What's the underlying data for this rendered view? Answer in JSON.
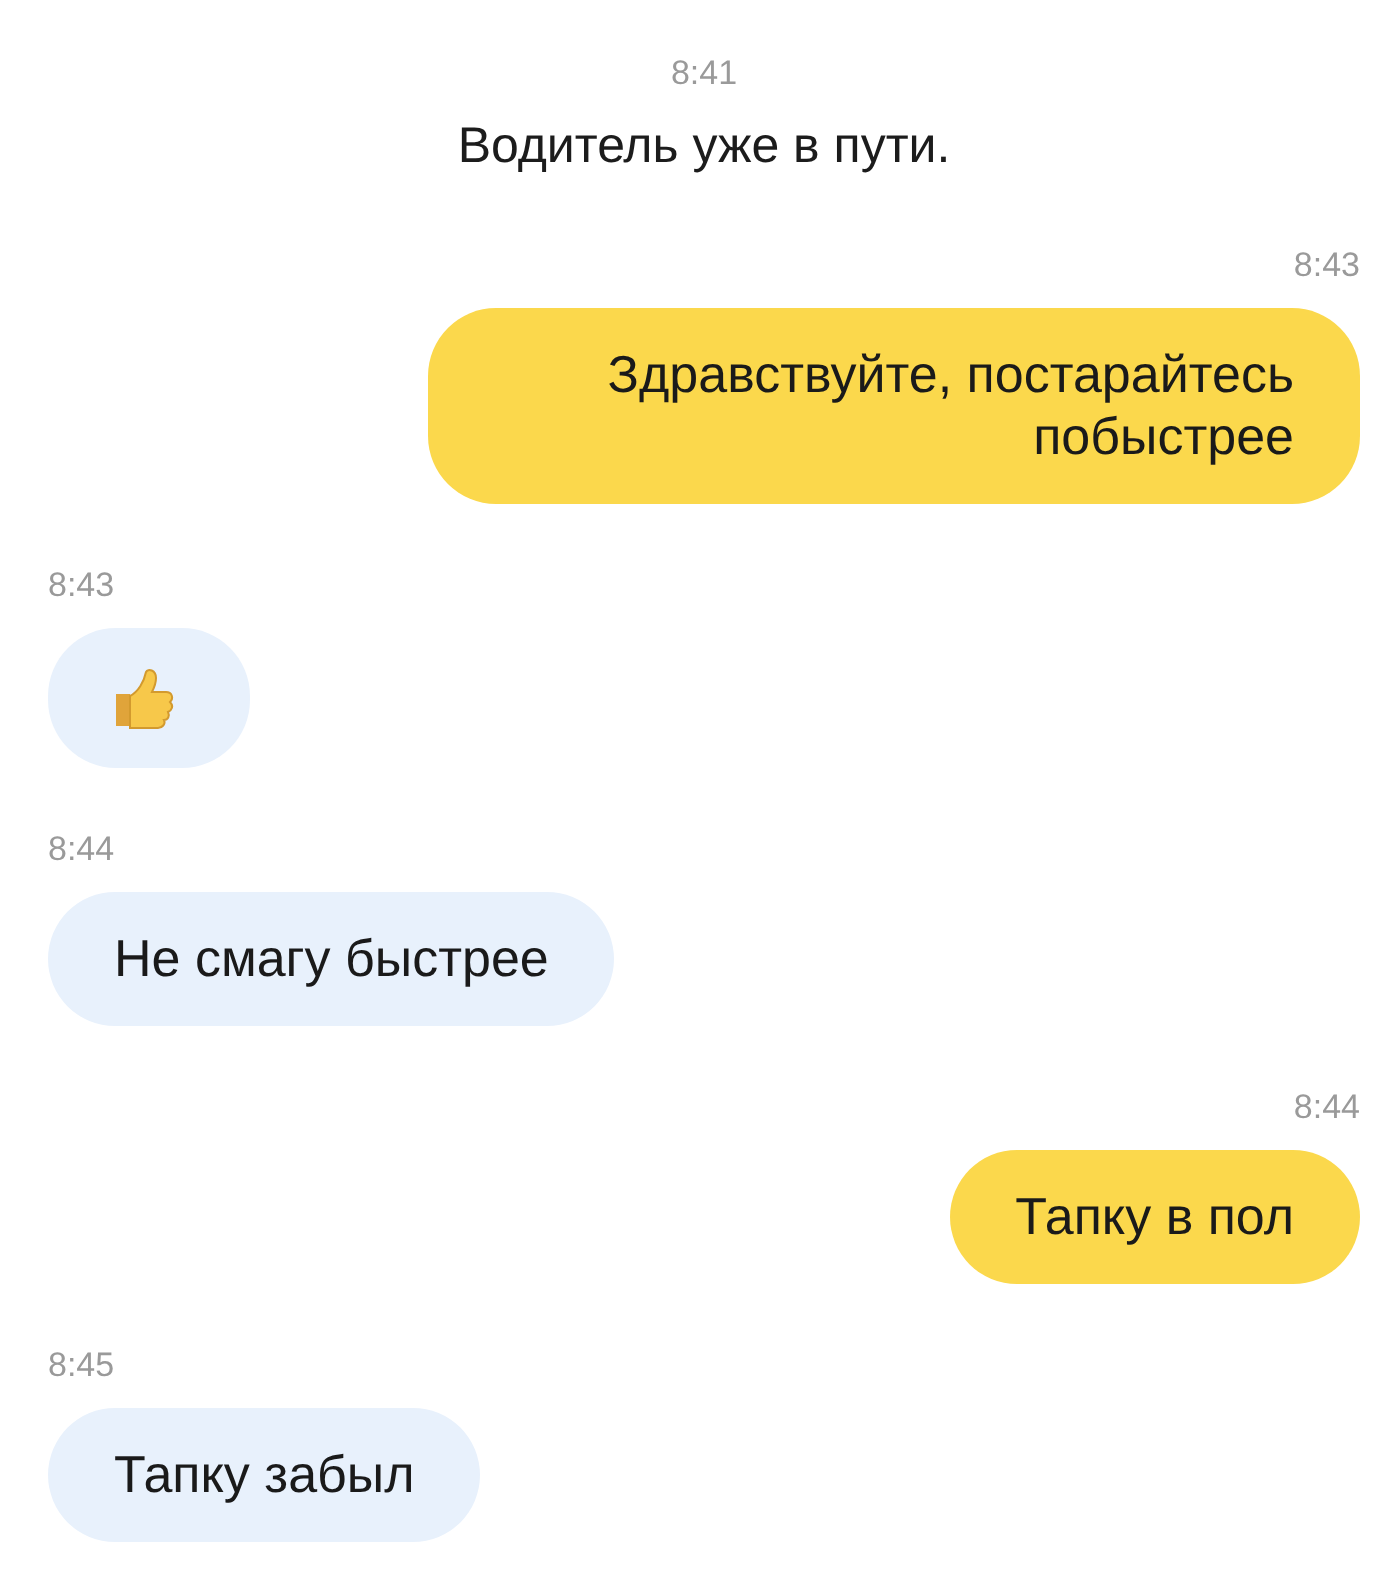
{
  "messages": [
    {
      "kind": "system",
      "time": "8:41",
      "text": "Водитель уже в пути."
    },
    {
      "kind": "text",
      "outgoing": true,
      "time": "8:43",
      "text": "Здравствуйте, постарайтесь побыстрее"
    },
    {
      "kind": "thumbs_up",
      "outgoing": false,
      "time": "8:43"
    },
    {
      "kind": "text",
      "outgoing": false,
      "time": "8:44",
      "text": "Не смагу быстрее"
    },
    {
      "kind": "text",
      "outgoing": true,
      "time": "8:44",
      "text": "Тапку в пол"
    },
    {
      "kind": "text",
      "outgoing": false,
      "time": "8:45",
      "text": "Тапку забыл"
    }
  ]
}
